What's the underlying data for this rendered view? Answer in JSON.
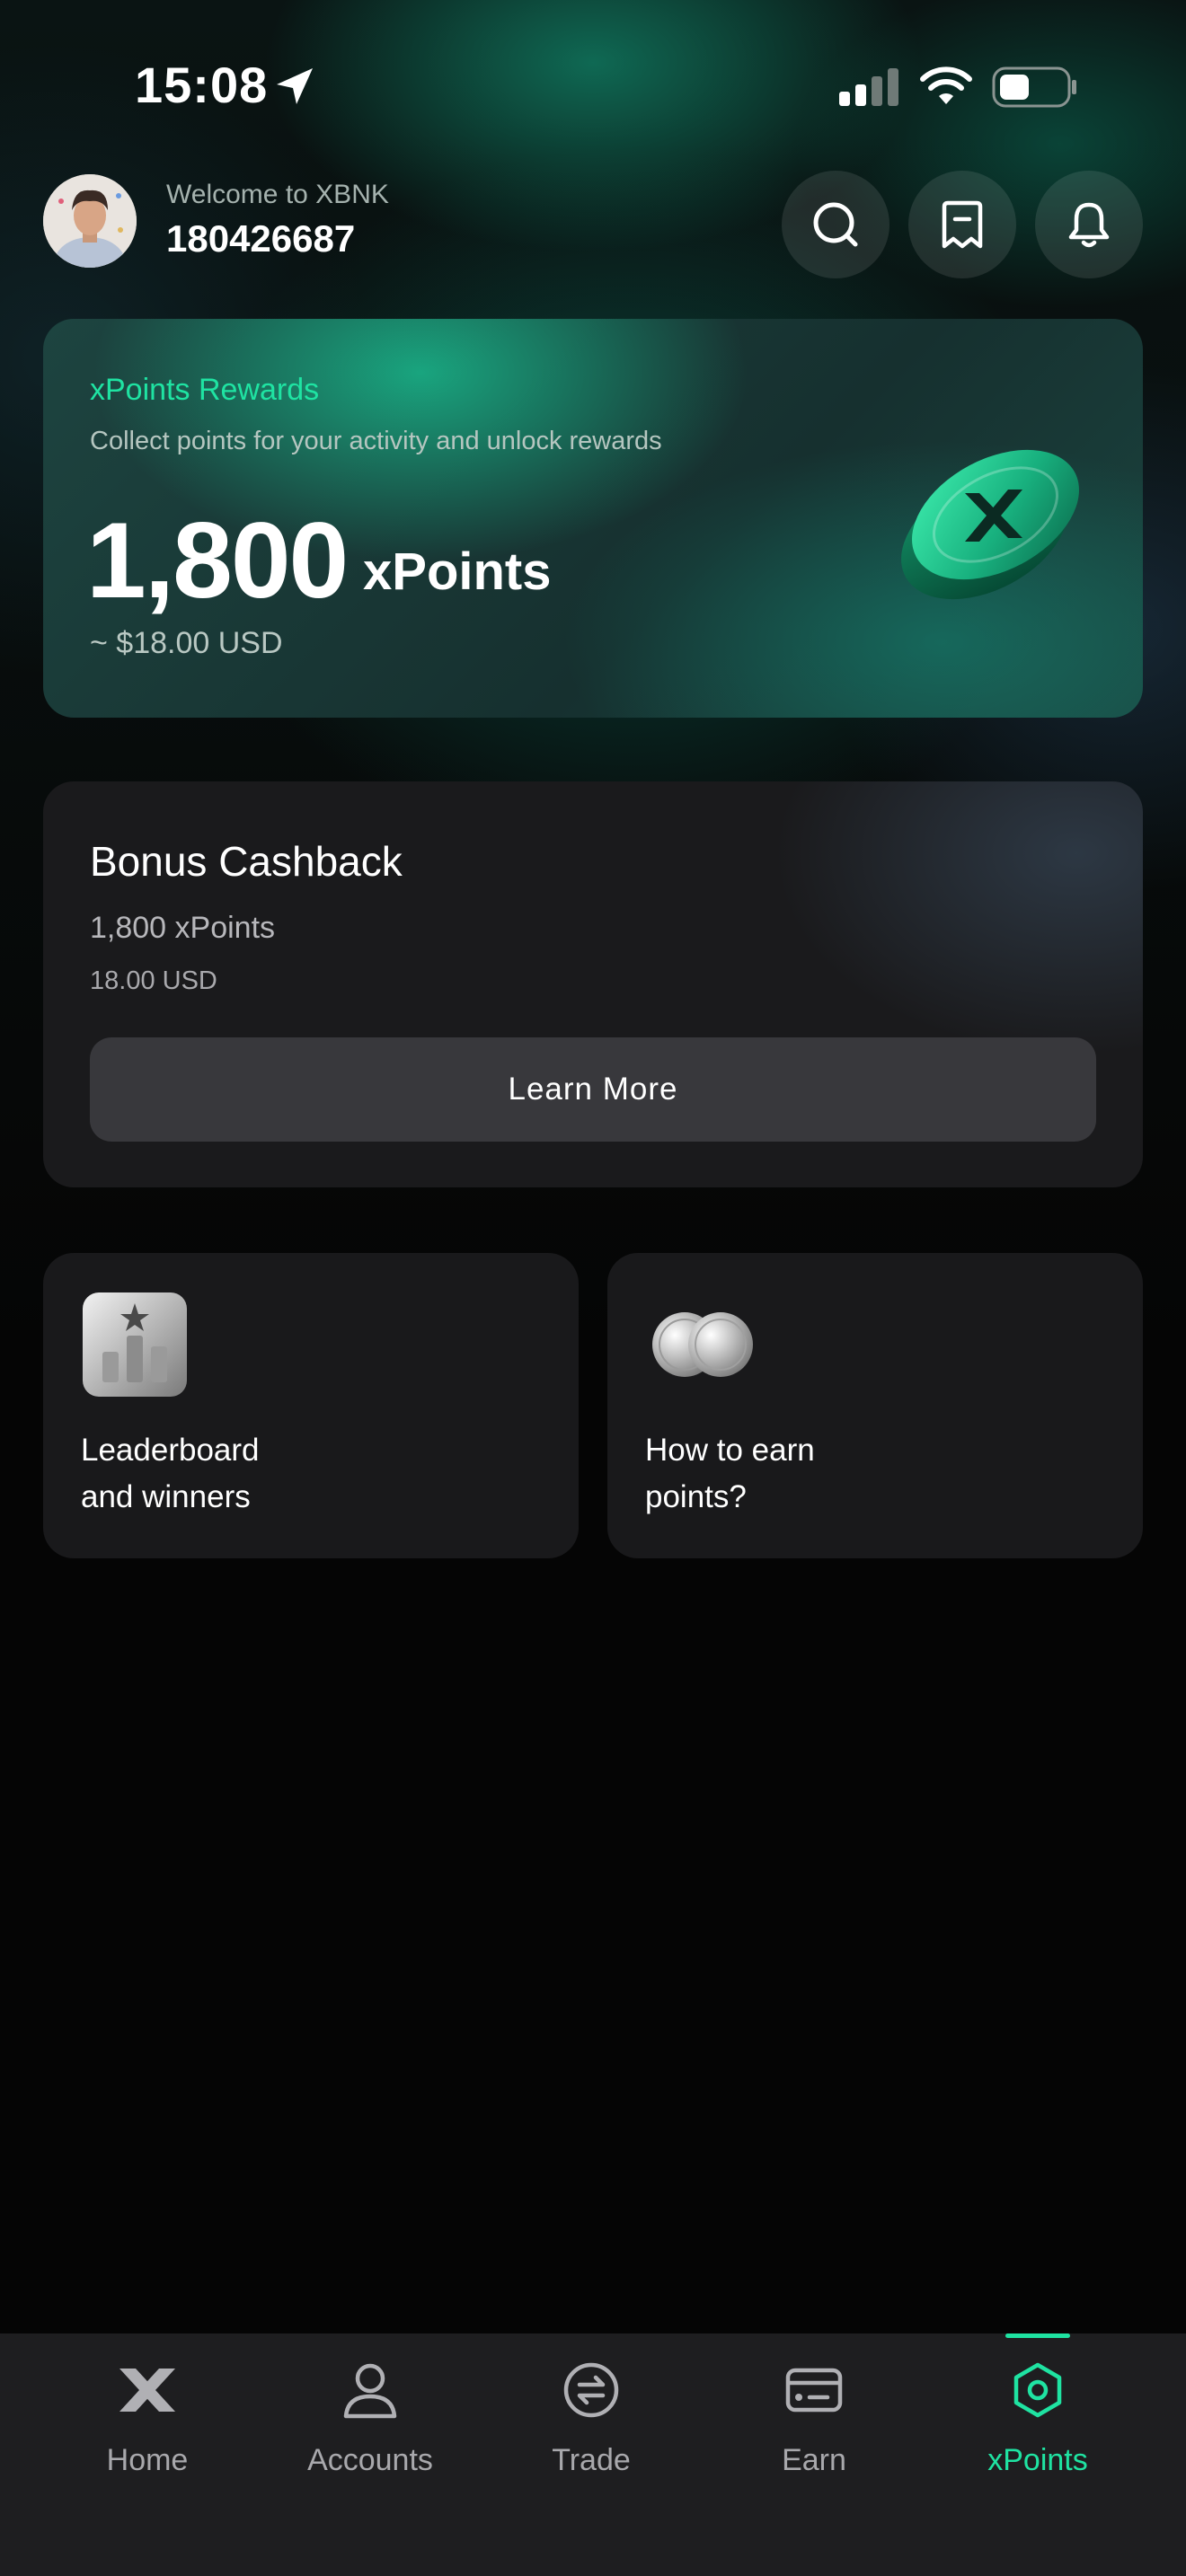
{
  "status_bar": {
    "time": "15:08",
    "icons": [
      "location-arrow-icon",
      "cellular-signal-icon",
      "wifi-icon",
      "battery-icon"
    ]
  },
  "header": {
    "welcome": "Welcome to XBNK",
    "user_id": "180426687",
    "buttons": [
      "search-icon",
      "receipt-icon",
      "bell-icon"
    ]
  },
  "rewards": {
    "title": "xPoints Rewards",
    "subtitle": "Collect points for your activity and unlock rewards",
    "amount": "1,800",
    "unit": "xPoints",
    "usd": "~ $18.00 USD"
  },
  "cashback": {
    "title": "Bonus Cashback",
    "points": "1,800 xPoints",
    "usd": "18.00 USD",
    "button": "Learn More"
  },
  "tiles": [
    {
      "line1": "Leaderboard",
      "line2": "and winners",
      "icon": "leaderboard-icon"
    },
    {
      "line1": "How to earn",
      "line2": "points?",
      "icon": "coins-icon"
    }
  ],
  "nav": {
    "items": [
      {
        "label": "Home",
        "icon": "x-logo-icon"
      },
      {
        "label": "Accounts",
        "icon": "user-icon"
      },
      {
        "label": "Trade",
        "icon": "exchange-icon"
      },
      {
        "label": "Earn",
        "icon": "card-icon"
      },
      {
        "label": "xPoints",
        "icon": "hexagon-icon"
      }
    ],
    "active": "xPoints",
    "accent_color": "#1fe3a2"
  }
}
